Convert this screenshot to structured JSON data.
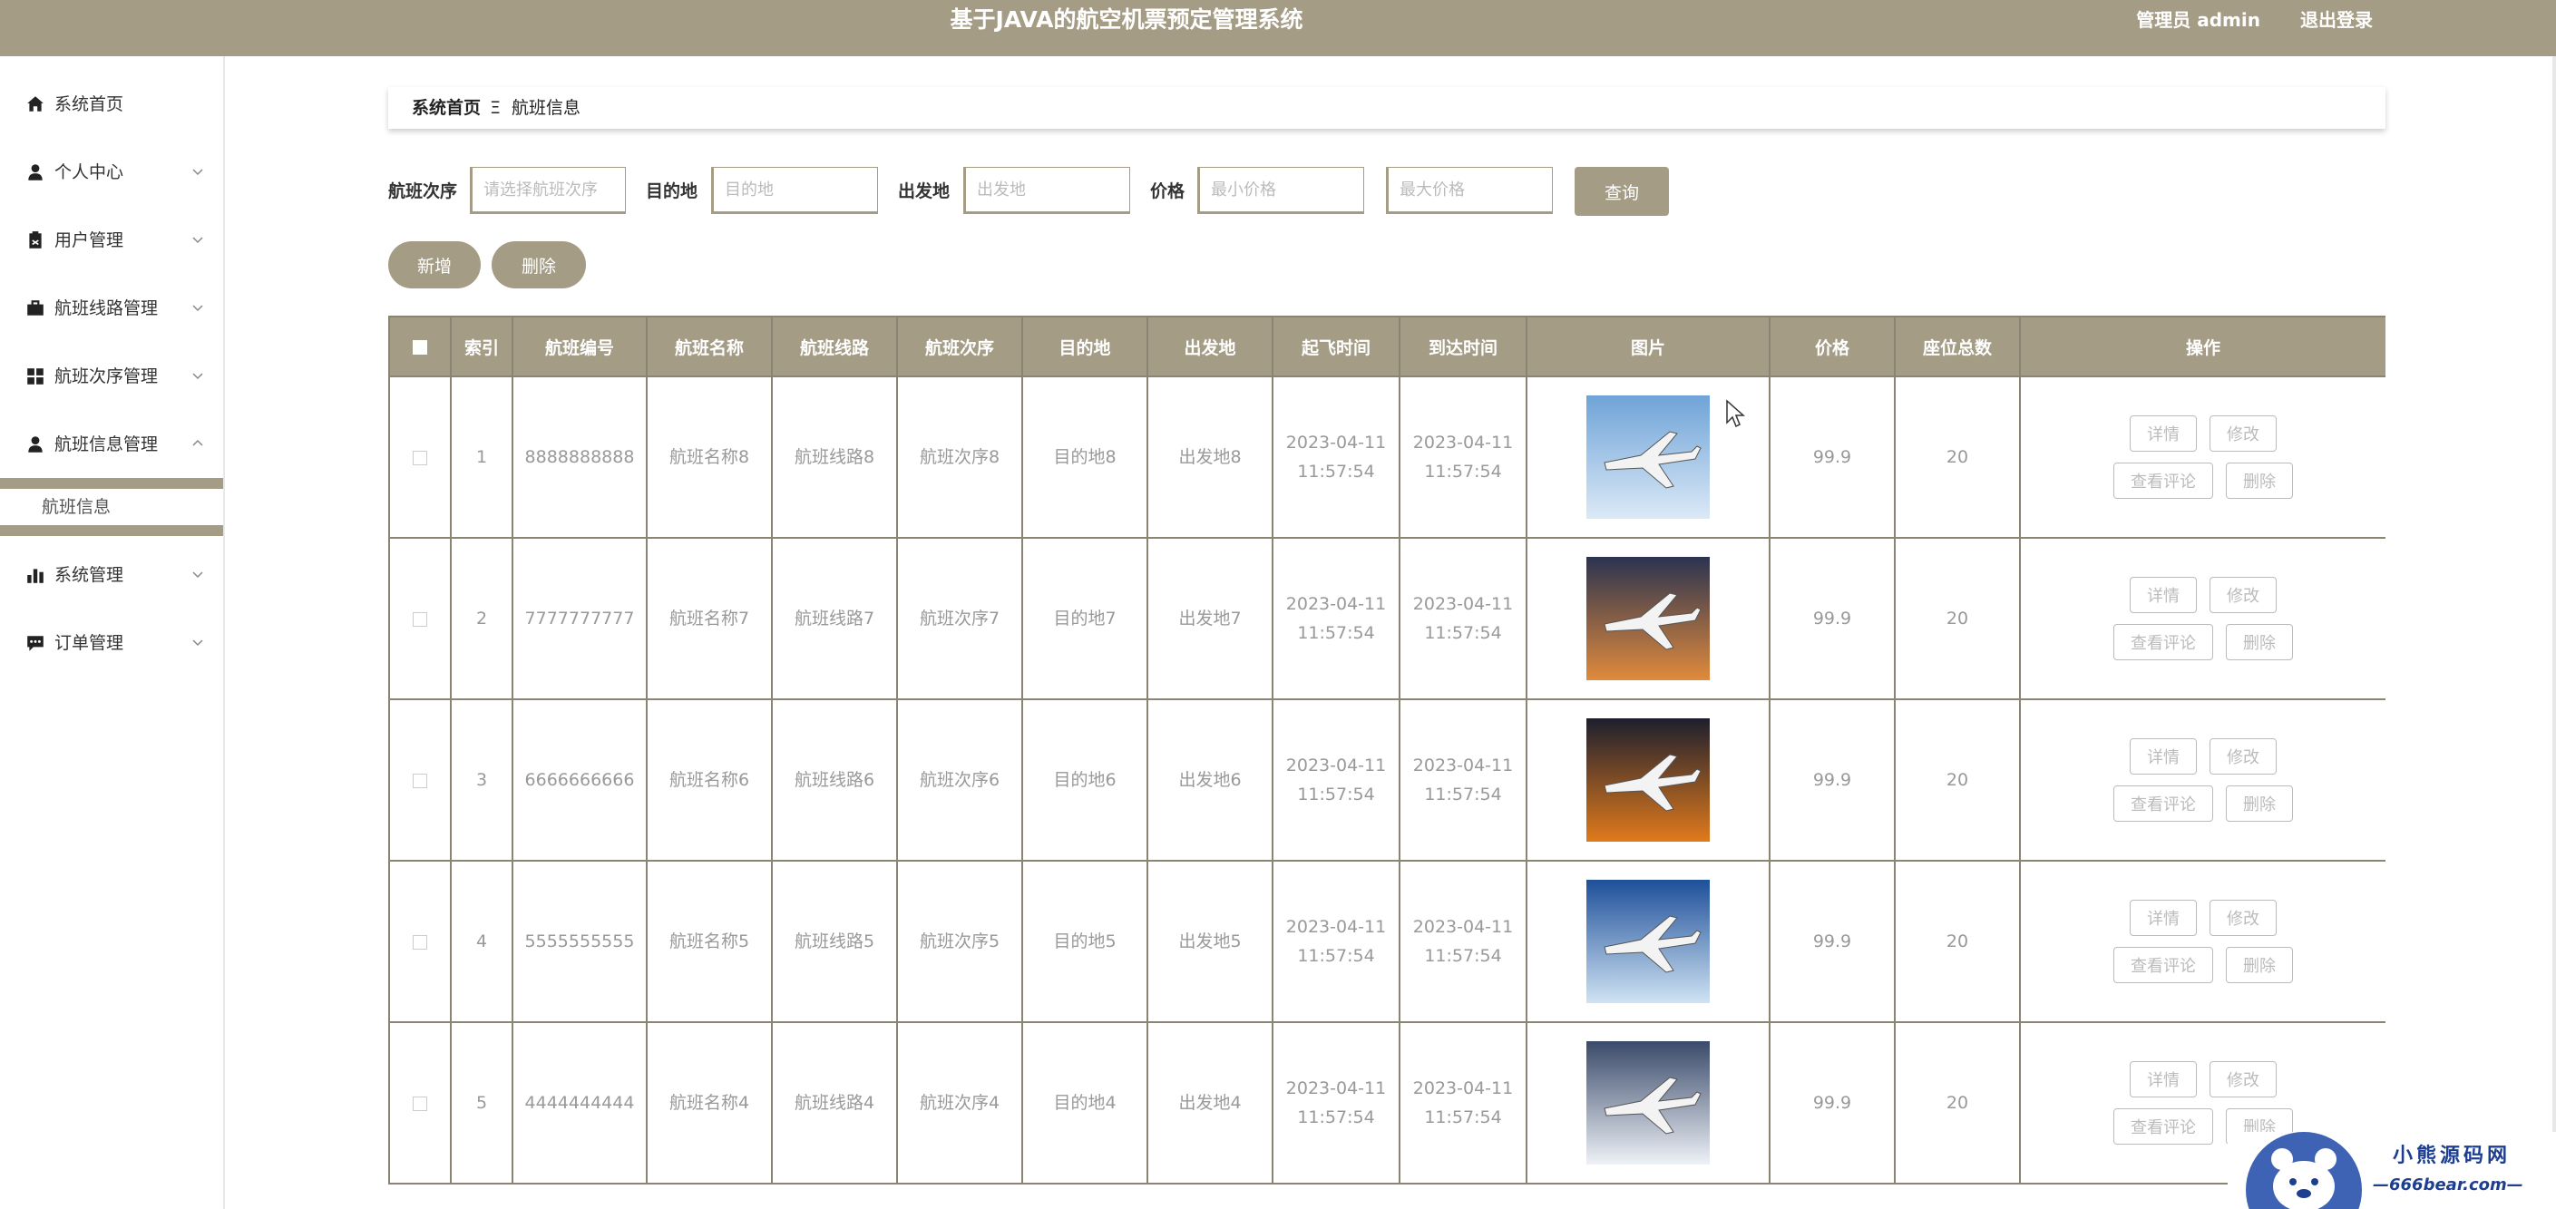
{
  "header": {
    "title": "基于JAVA的航空机票预定管理系统",
    "user": "管理员 admin",
    "logout": "退出登录"
  },
  "sidebar": {
    "items": [
      {
        "label": "系统首页",
        "icon": "home-icon",
        "expanded": false
      },
      {
        "label": "个人中心",
        "icon": "person-icon",
        "expanded": false
      },
      {
        "label": "用户管理",
        "icon": "clipboard-icon",
        "expanded": false
      },
      {
        "label": "航班线路管理",
        "icon": "briefcase-icon",
        "expanded": false
      },
      {
        "label": "航班次序管理",
        "icon": "grid-icon",
        "expanded": false
      },
      {
        "label": "航班信息管理",
        "icon": "person-icon",
        "expanded": true
      },
      {
        "label": "系统管理",
        "icon": "bar-chart-icon",
        "expanded": false
      },
      {
        "label": "订单管理",
        "icon": "chat-icon",
        "expanded": false
      }
    ],
    "active_sub": "航班信息"
  },
  "breadcrumb": {
    "home": "系统首页",
    "separator": "Ξ",
    "current": "航班信息"
  },
  "search": {
    "order_label": "航班次序",
    "order_placeholder": "请选择航班次序",
    "dest_label": "目的地",
    "dest_placeholder": "目的地",
    "origin_label": "出发地",
    "origin_placeholder": "出发地",
    "price_label": "价格",
    "min_placeholder": "最小价格",
    "max_placeholder": "最大价格",
    "query_button": "查询"
  },
  "actions": {
    "add": "新增",
    "delete": "删除"
  },
  "table": {
    "headers": [
      "索引",
      "航班编号",
      "航班名称",
      "航班线路",
      "航班次序",
      "目的地",
      "出发地",
      "起飞时间",
      "到达时间",
      "图片",
      "价格",
      "座位总数",
      "操作"
    ],
    "rows": [
      {
        "index": "1",
        "code": "8888888888",
        "name": "航班名称8",
        "route": "航班线路8",
        "order": "航班次序8",
        "dest": "目的地8",
        "origin": "出发地8",
        "dep_date": "2023-04-11",
        "dep_time": "11:57:54",
        "arr_date": "2023-04-11",
        "arr_time": "11:57:54",
        "price": "99.9",
        "seats": "20"
      },
      {
        "index": "2",
        "code": "7777777777",
        "name": "航班名称7",
        "route": "航班线路7",
        "order": "航班次序7",
        "dest": "目的地7",
        "origin": "出发地7",
        "dep_date": "2023-04-11",
        "dep_time": "11:57:54",
        "arr_date": "2023-04-11",
        "arr_time": "11:57:54",
        "price": "99.9",
        "seats": "20"
      },
      {
        "index": "3",
        "code": "6666666666",
        "name": "航班名称6",
        "route": "航班线路6",
        "order": "航班次序6",
        "dest": "目的地6",
        "origin": "出发地6",
        "dep_date": "2023-04-11",
        "dep_time": "11:57:54",
        "arr_date": "2023-04-11",
        "arr_time": "11:57:54",
        "price": "99.9",
        "seats": "20"
      },
      {
        "index": "4",
        "code": "5555555555",
        "name": "航班名称5",
        "route": "航班线路5",
        "order": "航班次序5",
        "dest": "目的地5",
        "origin": "出发地5",
        "dep_date": "2023-04-11",
        "dep_time": "11:57:54",
        "arr_date": "2023-04-11",
        "arr_time": "11:57:54",
        "price": "99.9",
        "seats": "20"
      },
      {
        "index": "5",
        "code": "4444444444",
        "name": "航班名称4",
        "route": "航班线路4",
        "order": "航班次序4",
        "dest": "目的地4",
        "origin": "出发地4",
        "dep_date": "2023-04-11",
        "dep_time": "11:57:54",
        "arr_date": "2023-04-11",
        "arr_time": "11:57:54",
        "price": "99.9",
        "seats": "20"
      }
    ],
    "row_actions": {
      "detail": "详情",
      "edit": "修改",
      "comments": "查看评论",
      "delete": "删除"
    }
  },
  "watermark": {
    "title": "小熊源码网",
    "url": "—666bear.com—"
  },
  "colors": {
    "accent": "#a59c86",
    "border": "#8a8472",
    "muted_text": "#999999"
  }
}
